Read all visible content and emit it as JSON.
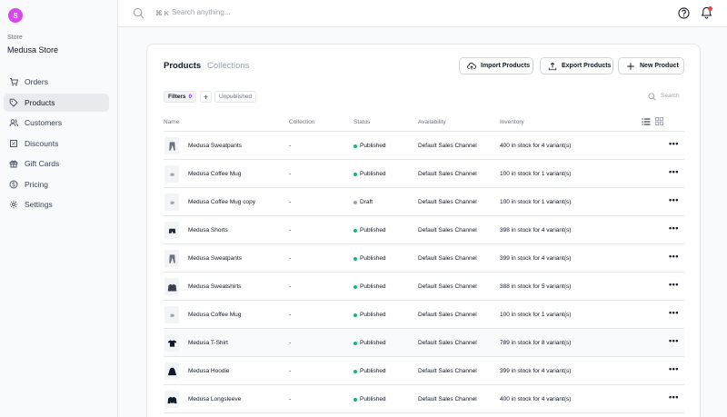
{
  "store": {
    "avatar_letter": "S",
    "label": "Store",
    "name": "Medusa Store"
  },
  "nav": [
    {
      "label": "Orders",
      "icon": "cart-icon",
      "active": false
    },
    {
      "label": "Products",
      "icon": "tag-icon",
      "active": true
    },
    {
      "label": "Customers",
      "icon": "users-icon",
      "active": false
    },
    {
      "label": "Discounts",
      "icon": "discount-icon",
      "active": false
    },
    {
      "label": "Gift Cards",
      "icon": "gift-icon",
      "active": false
    },
    {
      "label": "Pricing",
      "icon": "dollar-icon",
      "active": false
    },
    {
      "label": "Settings",
      "icon": "gear-icon",
      "active": false
    }
  ],
  "topbar": {
    "shortcut": "⌘ K",
    "search_placeholder": "Search anything..."
  },
  "tabs": {
    "products": "Products",
    "collections": "Collections"
  },
  "actions": {
    "import": "Import Products",
    "export": "Export Products",
    "new": "New Product"
  },
  "filters": {
    "label": "Filters",
    "count": "0",
    "add": "+",
    "active_filter": "Unpublished",
    "search_placeholder": "Search"
  },
  "columns": {
    "name": "Name",
    "collection": "Collection",
    "status": "Status",
    "availability": "Availability",
    "inventory": "Inventory"
  },
  "colors": {
    "published": "#10b981",
    "draft": "#9ca3af",
    "accent": "#7c3aed",
    "notification": "#ef4444"
  },
  "products": [
    {
      "name": "Medusa Sweatpants",
      "collection": "-",
      "status": "Published",
      "availability": "Default Sales Channel",
      "inventory": "400 in stock for 4 variant(s)",
      "thumb": "pants-icon"
    },
    {
      "name": "Medusa Coffee Mug",
      "collection": "-",
      "status": "Published",
      "availability": "Default Sales Channel",
      "inventory": "100 in stock for 1 variant(s)",
      "thumb": "mug-icon"
    },
    {
      "name": "Medusa Coffee Mug copy",
      "collection": "-",
      "status": "Draft",
      "availability": "Default Sales Channel",
      "inventory": "100 in stock for 1 variant(s)",
      "thumb": "mug-icon"
    },
    {
      "name": "Medusa Shorts",
      "collection": "-",
      "status": "Published",
      "availability": "Default Sales Channel",
      "inventory": "398 in stock for 4 variant(s)",
      "thumb": "shorts-icon"
    },
    {
      "name": "Medusa Sweatpants",
      "collection": "-",
      "status": "Published",
      "availability": "Default Sales Channel",
      "inventory": "399 in stock for 4 variant(s)",
      "thumb": "pants-icon"
    },
    {
      "name": "Medusa Sweatshirts",
      "collection": "-",
      "status": "Published",
      "availability": "Default Sales Channel",
      "inventory": "388 in stock for 5 variant(s)",
      "thumb": "sweatshirt-icon"
    },
    {
      "name": "Medusa Coffee Mug",
      "collection": "-",
      "status": "Published",
      "availability": "Default Sales Channel",
      "inventory": "100 in stock for 1 variant(s)",
      "thumb": "mug-icon"
    },
    {
      "name": "Medusa T-Shirt",
      "collection": "-",
      "status": "Published",
      "availability": "Default Sales Channel",
      "inventory": "789 in stock for 8 variant(s)",
      "thumb": "tshirt-icon"
    },
    {
      "name": "Medusa Hoodie",
      "collection": "-",
      "status": "Published",
      "availability": "Default Sales Channel",
      "inventory": "399 in stock for 4 variant(s)",
      "thumb": "hoodie-icon"
    },
    {
      "name": "Medusa Longsleeve",
      "collection": "-",
      "status": "Published",
      "availability": "Default Sales Channel",
      "inventory": "400 in stock for 4 variant(s)",
      "thumb": "longsleeve-icon"
    }
  ]
}
